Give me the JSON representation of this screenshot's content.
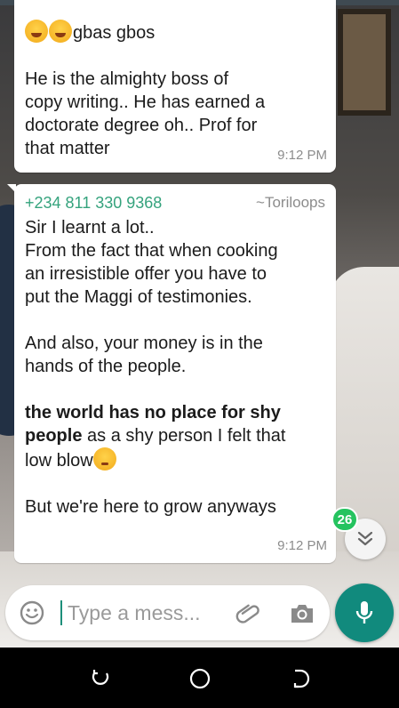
{
  "messages": [
    {
      "lines": [
        "gbas gbos",
        "",
        "He is the almighty boss of",
        "copy writing.. He has earned a",
        "doctorate degree oh.. Prof for",
        "that matter"
      ],
      "time": "9:12 PM"
    },
    {
      "sender_phone": "+234 811 330 9368",
      "sender_name": "~Toriloops",
      "lines": [
        "Sir I learnt a lot..",
        "From the fact that when cooking",
        "an irresistible offer you have to",
        "put the Maggi of testimonies.",
        "",
        "And also, your money is in the",
        "hands of the people."
      ],
      "bold_1": "the world has no place for shy",
      "bold_2": "people",
      "after_bold": " as a shy person I felt that",
      "low_blow": "low blow",
      "last_line": "But we're here to grow anyways",
      "time": "9:12 PM"
    }
  ],
  "unread_count": "26",
  "input": {
    "placeholder": "Type a mess..."
  },
  "icons": {
    "emoji": "smiley-icon",
    "attach": "paperclip-icon",
    "camera": "camera-icon",
    "mic": "mic-icon",
    "scroll": "double-chevron-down-icon"
  },
  "colors": {
    "accent": "#118a7d",
    "sender": "#35a37d",
    "unread_badge": "#25c35f"
  }
}
